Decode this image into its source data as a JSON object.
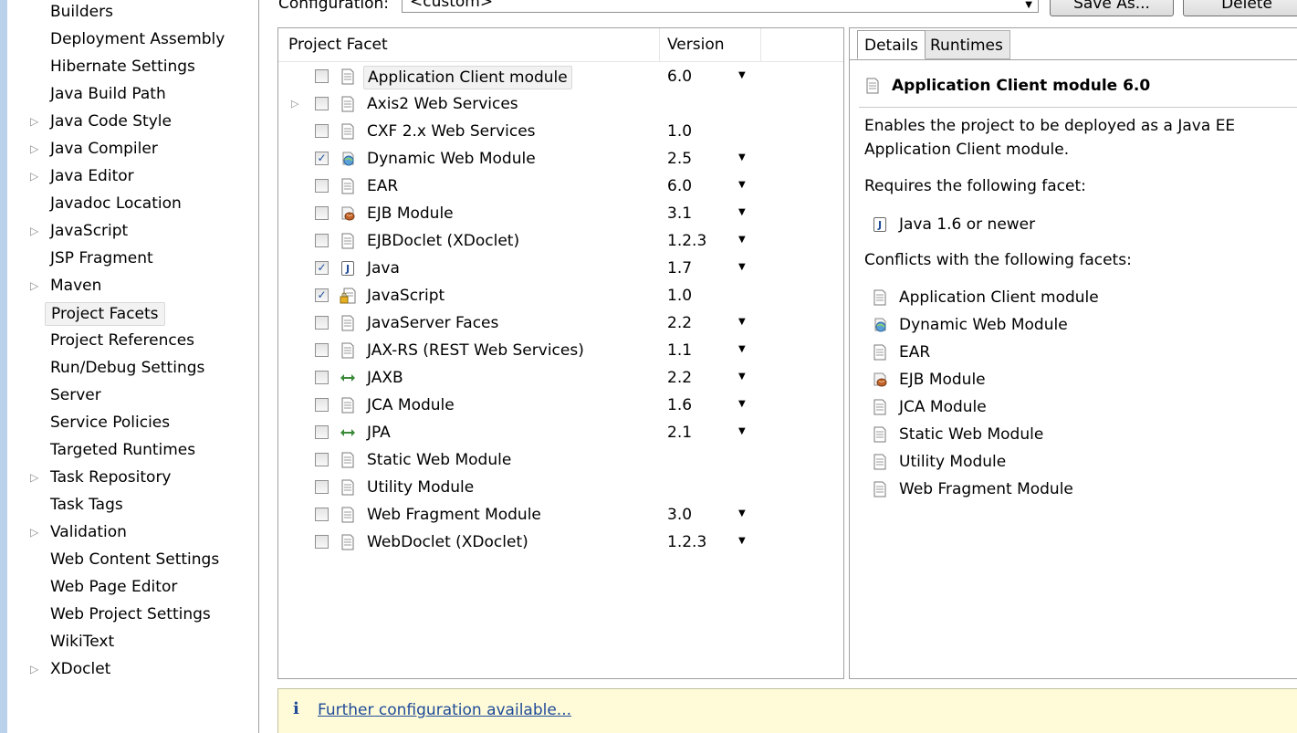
{
  "sidebar": {
    "items": [
      {
        "label": "Builders",
        "expandable": false
      },
      {
        "label": "Deployment Assembly",
        "expandable": false
      },
      {
        "label": "Hibernate Settings",
        "expandable": false
      },
      {
        "label": "Java Build Path",
        "expandable": false
      },
      {
        "label": "Java Code Style",
        "expandable": true
      },
      {
        "label": "Java Compiler",
        "expandable": true
      },
      {
        "label": "Java Editor",
        "expandable": true
      },
      {
        "label": "Javadoc Location",
        "expandable": false
      },
      {
        "label": "JavaScript",
        "expandable": true
      },
      {
        "label": "JSP Fragment",
        "expandable": false
      },
      {
        "label": "Maven",
        "expandable": true
      },
      {
        "label": "Project Facets",
        "expandable": false,
        "selected": true
      },
      {
        "label": "Project References",
        "expandable": false
      },
      {
        "label": "Run/Debug Settings",
        "expandable": false
      },
      {
        "label": "Server",
        "expandable": false
      },
      {
        "label": "Service Policies",
        "expandable": false
      },
      {
        "label": "Targeted Runtimes",
        "expandable": false
      },
      {
        "label": "Task Repository",
        "expandable": true
      },
      {
        "label": "Task Tags",
        "expandable": false
      },
      {
        "label": "Validation",
        "expandable": true
      },
      {
        "label": "Web Content Settings",
        "expandable": false
      },
      {
        "label": "Web Page Editor",
        "expandable": false
      },
      {
        "label": "Web Project Settings",
        "expandable": false
      },
      {
        "label": "WikiText",
        "expandable": false
      },
      {
        "label": "XDoclet",
        "expandable": true
      }
    ]
  },
  "config": {
    "label": "Configuration:",
    "value": "<custom>",
    "save_as": "Save As...",
    "delete": "Delete"
  },
  "facets": {
    "col_facet": "Project Facet",
    "col_version": "Version",
    "rows": [
      {
        "name": "Application Client module",
        "version": "6.0",
        "checked": false,
        "dropdown": true,
        "icon": "doc-icon",
        "selected": true
      },
      {
        "name": "Axis2 Web Services",
        "version": "",
        "checked": false,
        "dropdown": false,
        "icon": "doc-icon",
        "expandable": true
      },
      {
        "name": "CXF 2.x Web Services",
        "version": "1.0",
        "checked": false,
        "dropdown": false,
        "icon": "doc-icon"
      },
      {
        "name": "Dynamic Web Module",
        "version": "2.5",
        "checked": true,
        "dropdown": true,
        "icon": "globe-icon"
      },
      {
        "name": "EAR",
        "version": "6.0",
        "checked": false,
        "dropdown": true,
        "icon": "doc-icon"
      },
      {
        "name": "EJB Module",
        "version": "3.1",
        "checked": false,
        "dropdown": true,
        "icon": "bean-icon"
      },
      {
        "name": "EJBDoclet (XDoclet)",
        "version": "1.2.3",
        "checked": false,
        "dropdown": true,
        "icon": "doc-icon"
      },
      {
        "name": "Java",
        "version": "1.7",
        "checked": true,
        "dropdown": true,
        "icon": "java-icon"
      },
      {
        "name": "JavaScript",
        "version": "1.0",
        "checked": true,
        "dropdown": false,
        "icon": "js-lock-icon"
      },
      {
        "name": "JavaServer Faces",
        "version": "2.2",
        "checked": false,
        "dropdown": true,
        "icon": "doc-icon"
      },
      {
        "name": "JAX-RS (REST Web Services)",
        "version": "1.1",
        "checked": false,
        "dropdown": true,
        "icon": "doc-icon"
      },
      {
        "name": "JAXB",
        "version": "2.2",
        "checked": false,
        "dropdown": true,
        "icon": "arrows-icon"
      },
      {
        "name": "JCA Module",
        "version": "1.6",
        "checked": false,
        "dropdown": true,
        "icon": "doc-icon"
      },
      {
        "name": "JPA",
        "version": "2.1",
        "checked": false,
        "dropdown": true,
        "icon": "arrows-icon"
      },
      {
        "name": "Static Web Module",
        "version": "",
        "checked": false,
        "dropdown": false,
        "icon": "doc-icon"
      },
      {
        "name": "Utility Module",
        "version": "",
        "checked": false,
        "dropdown": false,
        "icon": "doc-icon"
      },
      {
        "name": "Web Fragment Module",
        "version": "3.0",
        "checked": false,
        "dropdown": true,
        "icon": "doc-icon"
      },
      {
        "name": "WebDoclet (XDoclet)",
        "version": "1.2.3",
        "checked": false,
        "dropdown": true,
        "icon": "doc-icon"
      }
    ]
  },
  "details": {
    "tab_details": "Details",
    "tab_runtimes": "Runtimes",
    "title": "Application Client module 6.0",
    "description_line1": "Enables the project to be deployed as a Java EE",
    "description_line2": "Application Client module.",
    "requires_label": "Requires the following facet:",
    "requires": [
      {
        "name": "Java 1.6 or newer",
        "icon": "java-icon"
      }
    ],
    "conflicts_label": "Conflicts with the following facets:",
    "conflicts": [
      {
        "name": "Application Client module",
        "icon": "doc-icon"
      },
      {
        "name": "Dynamic Web Module",
        "icon": "globe-icon"
      },
      {
        "name": "EAR",
        "icon": "doc-icon"
      },
      {
        "name": "EJB Module",
        "icon": "bean-icon"
      },
      {
        "name": "JCA Module",
        "icon": "doc-icon"
      },
      {
        "name": "Static Web Module",
        "icon": "doc-icon"
      },
      {
        "name": "Utility Module",
        "icon": "doc-icon"
      },
      {
        "name": "Web Fragment Module",
        "icon": "doc-icon"
      }
    ]
  },
  "infobar": {
    "icon": "info-icon",
    "link": "Further configuration available..."
  }
}
